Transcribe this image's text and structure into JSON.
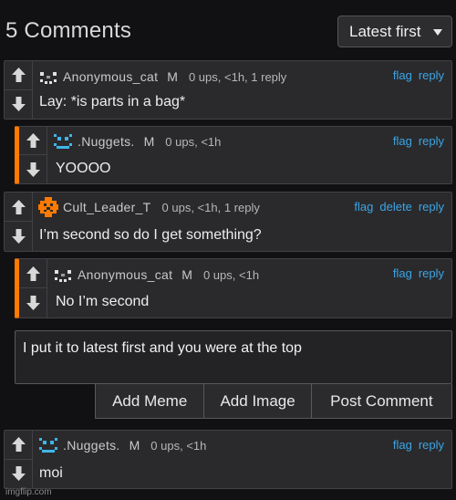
{
  "header": {
    "title": "5 Comments",
    "sort": {
      "selected": "Latest first"
    }
  },
  "comments": [
    {
      "username": "Anonymous_cat",
      "badge": "M",
      "stats": "0 ups, <1h, 1 reply",
      "actions": [
        "flag",
        "reply"
      ],
      "text": "Lay: *is parts in a bag*",
      "avatar": "anonymous-cat-avatar"
    },
    {
      "username": ".Nuggets.",
      "badge": "M",
      "stats": "0 ups, <1h",
      "actions": [
        "flag",
        "reply"
      ],
      "text": "YOOOO",
      "avatar": "nuggets-avatar"
    },
    {
      "username": "Cult_Leader_T",
      "badge": "",
      "stats": "0 ups, <1h, 1 reply",
      "actions": [
        "flag",
        "delete",
        "reply"
      ],
      "text": "I’m second so do I get something?",
      "avatar": "cult-leader-avatar"
    },
    {
      "username": "Anonymous_cat",
      "badge": "M",
      "stats": "0 ups, <1h",
      "actions": [
        "flag",
        "reply"
      ],
      "text": "No I’m second",
      "avatar": "anonymous-cat-avatar"
    },
    {
      "username": ".Nuggets.",
      "badge": "M",
      "stats": "0 ups, <1h",
      "actions": [
        "flag",
        "reply"
      ],
      "text": "moi",
      "avatar": "nuggets-avatar"
    }
  ],
  "compose": {
    "text": "I put it to latest first and you were at the top",
    "buttons": [
      "Add Meme",
      "Add Image",
      "Post Comment"
    ]
  },
  "watermark": "imgflip.com",
  "colors": {
    "background": "#111113",
    "card": "#2a2a2d",
    "reply_accent": "#ff7a00",
    "link": "#3aa6e6",
    "nuggets_avatar": "#3fb5e8",
    "cult_avatar": "#ff7a00"
  }
}
